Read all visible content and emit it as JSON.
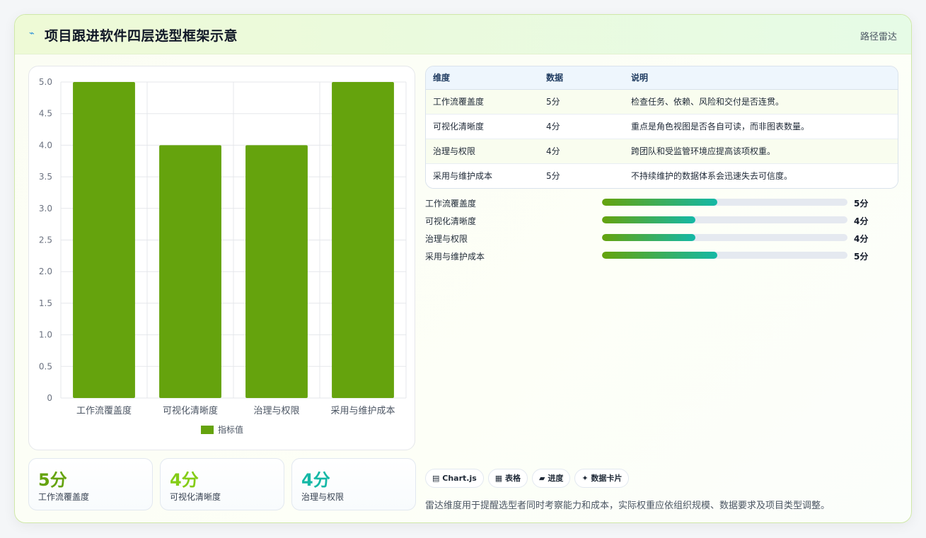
{
  "header": {
    "icon": "chart-line-icon",
    "title": "项目跟进软件四层选型框架示意",
    "link": "路径雷达"
  },
  "chart_data": {
    "type": "bar",
    "categories": [
      "工作流覆盖度",
      "可视化清晰度",
      "治理与权限",
      "采用与维护成本"
    ],
    "series": [
      {
        "name": "指标值",
        "values": [
          5,
          4,
          4,
          5
        ],
        "color": "#65a30d"
      }
    ],
    "ylim": [
      0,
      5
    ],
    "yticks": [
      "0",
      "0.5",
      "1.0",
      "1.5",
      "2.0",
      "2.5",
      "3.0",
      "3.5",
      "4.0",
      "4.5",
      "5.0"
    ],
    "grid": true,
    "legend": "bottom"
  },
  "stats": [
    {
      "value": "5分",
      "label": "工作流覆盖度",
      "color": "#65a30d"
    },
    {
      "value": "4分",
      "label": "可视化清晰度",
      "color": "#84cc16"
    },
    {
      "value": "4分",
      "label": "治理与权限",
      "color": "#14b8a6"
    }
  ],
  "table": {
    "headers": [
      "维度",
      "数据",
      "说明"
    ],
    "rows": [
      [
        "工作流覆盖度",
        "5分",
        "检查任务、依赖、风险和交付是否连贯。"
      ],
      [
        "可视化清晰度",
        "4分",
        "重点是角色视图是否各自可读，而非图表数量。"
      ],
      [
        "治理与权限",
        "4分",
        "跨团队和受监管环境应提高该项权重。"
      ],
      [
        "采用与维护成本",
        "5分",
        "不持续维护的数据体系会迅速失去可信度。"
      ]
    ]
  },
  "progress": [
    {
      "label": "工作流覆盖度",
      "value": "5分",
      "fraction": 0.47
    },
    {
      "label": "可视化清晰度",
      "value": "4分",
      "fraction": 0.38
    },
    {
      "label": "治理与权限",
      "value": "4分",
      "fraction": 0.38
    },
    {
      "label": "采用与维护成本",
      "value": "5分",
      "fraction": 0.47
    }
  ],
  "chips": [
    {
      "icon": "bar-chart-icon",
      "glyph": "▤",
      "label": "Chart.js"
    },
    {
      "icon": "table-icon",
      "glyph": "▦",
      "label": "表格"
    },
    {
      "icon": "progress-icon",
      "glyph": "▰",
      "label": "进度"
    },
    {
      "icon": "card-icon",
      "glyph": "✦",
      "label": "数据卡片"
    }
  ],
  "footer_note": "雷达维度用于提醒选型者同时考察能力和成本，实际权重应依组织规模、数据要求及项目类型调整。"
}
